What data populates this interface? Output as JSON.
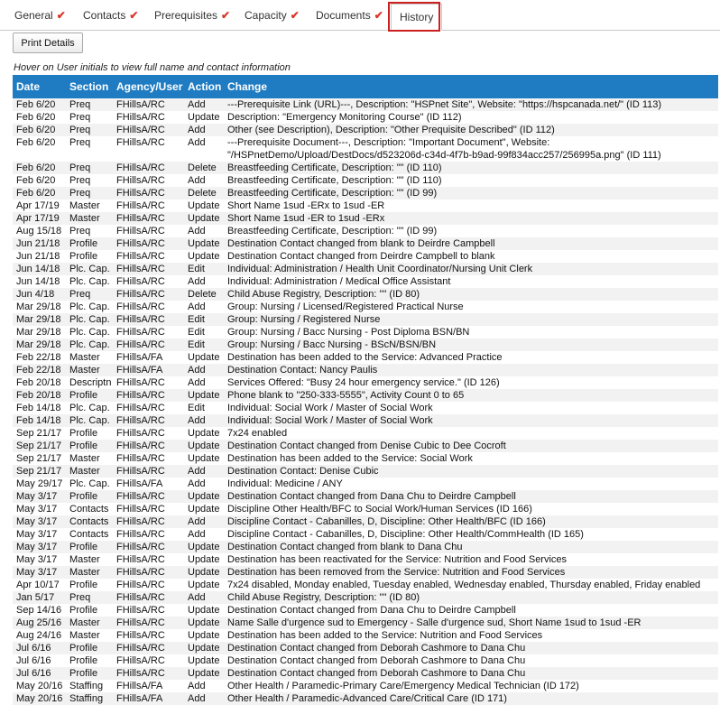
{
  "tabs": [
    {
      "label": "General",
      "checked": true
    },
    {
      "label": "Contacts",
      "checked": true
    },
    {
      "label": "Prerequisites",
      "checked": true
    },
    {
      "label": "Capacity",
      "checked": true
    },
    {
      "label": "Documents",
      "checked": true
    },
    {
      "label": "History",
      "checked": false,
      "active": true
    }
  ],
  "check_glyph": "✔",
  "print_button_label": "Print Details",
  "hint": "Hover on User initials to view full name and contact information",
  "columns": [
    "Date",
    "Section",
    "Agency/User",
    "Action",
    "Change"
  ],
  "rows": [
    [
      "Feb 6/20",
      "Preq",
      "FHillsA/RC",
      "Add",
      "---Prerequisite Link (URL)---, Description: \"HSPnet Site\", Website: \"https://hspcanada.net/\" (ID 113)"
    ],
    [
      "Feb 6/20",
      "Preq",
      "FHillsA/RC",
      "Update",
      "Description: \"Emergency Monitoring Course\" (ID 112)"
    ],
    [
      "Feb 6/20",
      "Preq",
      "FHillsA/RC",
      "Add",
      "Other (see Description), Description: \"Other Prequisite Described\" (ID 112)"
    ],
    [
      "Feb 6/20",
      "Preq",
      "FHillsA/RC",
      "Add",
      "---Prerequisite Document---, Description: \"Important Document\", Website: \"/HSPnetDemo/Upload/DestDocs/d523206d-c34d-4f7b-b9ad-99f834acc257/256995a.png\" (ID 111)"
    ],
    [
      "Feb 6/20",
      "Preq",
      "FHillsA/RC",
      "Delete",
      "Breastfeeding Certificate, Description: \"\" (ID 110)"
    ],
    [
      "Feb 6/20",
      "Preq",
      "FHillsA/RC",
      "Add",
      "Breastfeeding Certificate, Description: \"\" (ID 110)"
    ],
    [
      "Feb 6/20",
      "Preq",
      "FHillsA/RC",
      "Delete",
      "Breastfeeding Certificate, Description: \"\" (ID 99)"
    ],
    [
      "Apr 17/19",
      "Master",
      "FHillsA/RC",
      "Update",
      "Short Name 1sud -ERx to 1sud -ER"
    ],
    [
      "Apr 17/19",
      "Master",
      "FHillsA/RC",
      "Update",
      "Short Name 1sud -ER to 1sud -ERx"
    ],
    [
      "Aug 15/18",
      "Preq",
      "FHillsA/RC",
      "Add",
      "Breastfeeding Certificate, Description: \"\" (ID 99)"
    ],
    [
      "Jun 21/18",
      "Profile",
      "FHillsA/RC",
      "Update",
      "Destination Contact changed from blank to Deirdre Campbell"
    ],
    [
      "Jun 21/18",
      "Profile",
      "FHillsA/RC",
      "Update",
      "Destination Contact changed from Deirdre Campbell to blank"
    ],
    [
      "Jun 14/18",
      "Plc. Cap.",
      "FHillsA/RC",
      "Edit",
      "Individual: Administration / Health Unit Coordinator/Nursing Unit Clerk"
    ],
    [
      "Jun 14/18",
      "Plc. Cap.",
      "FHillsA/RC",
      "Add",
      "Individual: Administration / Medical Office Assistant"
    ],
    [
      "Jun 4/18",
      "Preq",
      "FHillsA/RC",
      "Delete",
      "Child Abuse Registry, Description: \"\" (ID 80)"
    ],
    [
      "Mar 29/18",
      "Plc. Cap.",
      "FHillsA/RC",
      "Add",
      "Group: Nursing / Licensed/Registered Practical Nurse"
    ],
    [
      "Mar 29/18",
      "Plc. Cap.",
      "FHillsA/RC",
      "Edit",
      "Group: Nursing / Registered Nurse"
    ],
    [
      "Mar 29/18",
      "Plc. Cap.",
      "FHillsA/RC",
      "Edit",
      "Group: Nursing / Bacc Nursing - Post Diploma BSN/BN"
    ],
    [
      "Mar 29/18",
      "Plc. Cap.",
      "FHillsA/RC",
      "Edit",
      "Group: Nursing / Bacc Nursing - BScN/BSN/BN"
    ],
    [
      "Feb 22/18",
      "Master",
      "FHillsA/FA",
      "Update",
      "Destination has been added to the Service: Advanced Practice"
    ],
    [
      "Feb 22/18",
      "Master",
      "FHillsA/FA",
      "Add",
      "Destination Contact: Nancy Paulis"
    ],
    [
      "Feb 20/18",
      "Descriptn",
      "FHillsA/RC",
      "Add",
      "Services Offered: \"Busy 24 hour emergency service.\" (ID 126)"
    ],
    [
      "Feb 20/18",
      "Profile",
      "FHillsA/RC",
      "Update",
      "Phone blank to \"250-333-5555\", Activity Count 0 to 65"
    ],
    [
      "Feb 14/18",
      "Plc. Cap.",
      "FHillsA/RC",
      "Edit",
      "Individual: Social Work / Master of Social Work"
    ],
    [
      "Feb 14/18",
      "Plc. Cap.",
      "FHillsA/RC",
      "Add",
      "Individual: Social Work / Master of Social Work"
    ],
    [
      "Sep 21/17",
      "Profile",
      "FHillsA/RC",
      "Update",
      "7x24 enabled"
    ],
    [
      "Sep 21/17",
      "Profile",
      "FHillsA/RC",
      "Update",
      "Destination Contact changed from Denise Cubic to Dee Cocroft"
    ],
    [
      "Sep 21/17",
      "Master",
      "FHillsA/RC",
      "Update",
      "Destination has been added to the Service: Social Work"
    ],
    [
      "Sep 21/17",
      "Master",
      "FHillsA/RC",
      "Add",
      "Destination Contact: Denise Cubic"
    ],
    [
      "May 29/17",
      "Plc. Cap.",
      "FHillsA/FA",
      "Add",
      "Individual: Medicine / ANY"
    ],
    [
      "May 3/17",
      "Profile",
      "FHillsA/RC",
      "Update",
      "Destination Contact changed from Dana Chu to Deirdre Campbell"
    ],
    [
      "May 3/17",
      "Contacts",
      "FHillsA/RC",
      "Update",
      "Discipline Other Health/BFC to Social Work/Human Services (ID 166)"
    ],
    [
      "May 3/17",
      "Contacts",
      "FHillsA/RC",
      "Add",
      "Discipline Contact - Cabanilles, D, Discipline: Other Health/BFC (ID 166)"
    ],
    [
      "May 3/17",
      "Contacts",
      "FHillsA/RC",
      "Add",
      "Discipline Contact - Cabanilles, D, Discipline: Other Health/CommHealth (ID 165)"
    ],
    [
      "May 3/17",
      "Profile",
      "FHillsA/RC",
      "Update",
      "Destination Contact changed from blank to Dana Chu"
    ],
    [
      "May 3/17",
      "Master",
      "FHillsA/RC",
      "Update",
      "Destination has been reactivated for the Service: Nutrition and Food Services"
    ],
    [
      "May 3/17",
      "Master",
      "FHillsA/RC",
      "Update",
      "Destination has been removed from the Service: Nutrition and Food Services"
    ],
    [
      "Apr 10/17",
      "Profile",
      "FHillsA/RC",
      "Update",
      "7x24 disabled, Monday enabled, Tuesday enabled, Wednesday enabled, Thursday enabled, Friday enabled"
    ],
    [
      "Jan 5/17",
      "Preq",
      "FHillsA/RC",
      "Add",
      "Child Abuse Registry, Description: \"\" (ID 80)"
    ],
    [
      "Sep 14/16",
      "Profile",
      "FHillsA/RC",
      "Update",
      "Destination Contact changed from Dana Chu to Deirdre Campbell"
    ],
    [
      "Aug 25/16",
      "Master",
      "FHillsA/RC",
      "Update",
      "Name Salle d'urgence sud to Emergency - Salle d'urgence sud, Short Name 1sud to 1sud -ER"
    ],
    [
      "Aug 24/16",
      "Master",
      "FHillsA/RC",
      "Update",
      "Destination has been added to the Service: Nutrition and Food Services"
    ],
    [
      "Jul 6/16",
      "Profile",
      "FHillsA/RC",
      "Update",
      "Destination Contact changed from Deborah Cashmore to Dana Chu"
    ],
    [
      "Jul 6/16",
      "Profile",
      "FHillsA/RC",
      "Update",
      "Destination Contact changed from Deborah Cashmore to Dana Chu"
    ],
    [
      "Jul 6/16",
      "Profile",
      "FHillsA/RC",
      "Update",
      "Destination Contact changed from Deborah Cashmore to Dana Chu"
    ],
    [
      "May 20/16",
      "Staffing",
      "FHillsA/FA",
      "Add",
      "Other Health / Paramedic-Primary Care/Emergency Medical Technician (ID 172)"
    ],
    [
      "May 20/16",
      "Staffing",
      "FHillsA/FA",
      "Add",
      "Other Health / Paramedic-Advanced Care/Critical Care (ID 171)"
    ]
  ],
  "colors": {
    "header_bg": "#1f7cc2",
    "check": "#d9362b",
    "highlight": "#cc1f1f",
    "row_alt": "#f2f2f2"
  }
}
